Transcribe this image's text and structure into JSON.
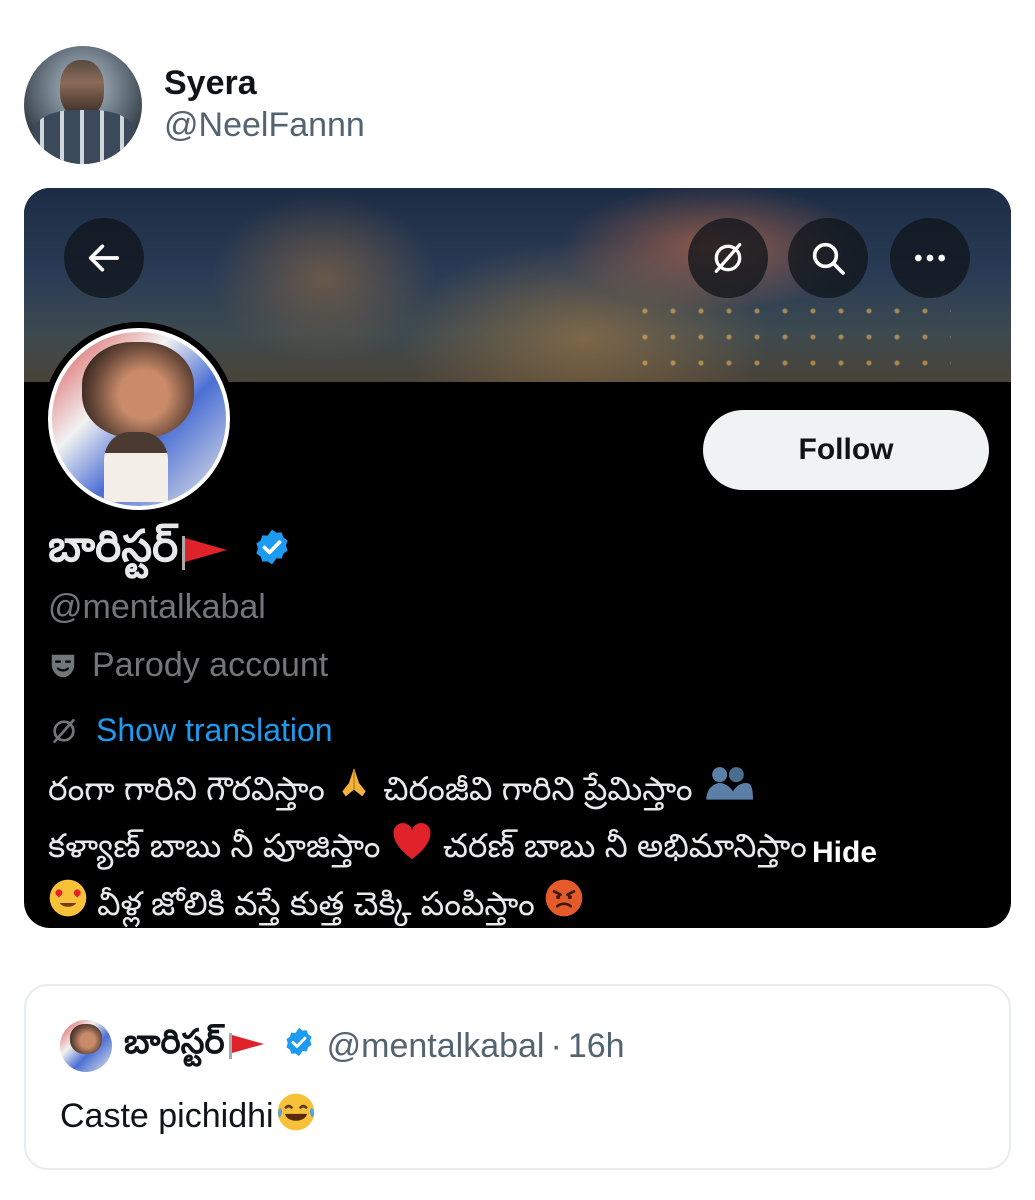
{
  "author": {
    "name": "Syera",
    "handle": "@NeelFannn"
  },
  "profile": {
    "display_name": "బారిస్టర్",
    "handle": "@mentalkabal",
    "account_label": "Parody account",
    "translate_label": "Show translation",
    "follow_label": "Follow",
    "bio_lines": [
      "రంగా గారిని గౌరవిస్తాం",
      "చిరంజీవి గారిని ప్రేమిస్తాం",
      "కళ్యాణ్ బాబు నీ పూజిస్తాం",
      "చరణ్ బాబు నీ అభిమానిస్తాం",
      "వీళ్ల జోలికి వస్తే కుత్త చెక్కి పంపిస్తాం"
    ],
    "hide_label": "Hide",
    "verified_color": "#1d9bf0",
    "accent_link_color": "#1d9bf0"
  },
  "quoted": {
    "name": "బారిస్టర్",
    "handle": "@mentalkabal",
    "separator": "·",
    "time": "16h",
    "text": "Caste pichidhi"
  },
  "icons": {
    "back": "arrow-left-icon",
    "translate": "translate-slash-icon",
    "search": "search-icon",
    "more": "more-dots-icon",
    "verified": "verified-badge-icon",
    "parody": "theater-mask-icon",
    "flag": "red-flag-emoji",
    "pray": "folded-hands-emoji",
    "hug": "people-hugging-emoji",
    "heart": "red-heart-emoji",
    "heart_eyes": "heart-eyes-emoji",
    "angry": "angry-face-emoji",
    "laughing": "tears-of-joy-emoji"
  }
}
